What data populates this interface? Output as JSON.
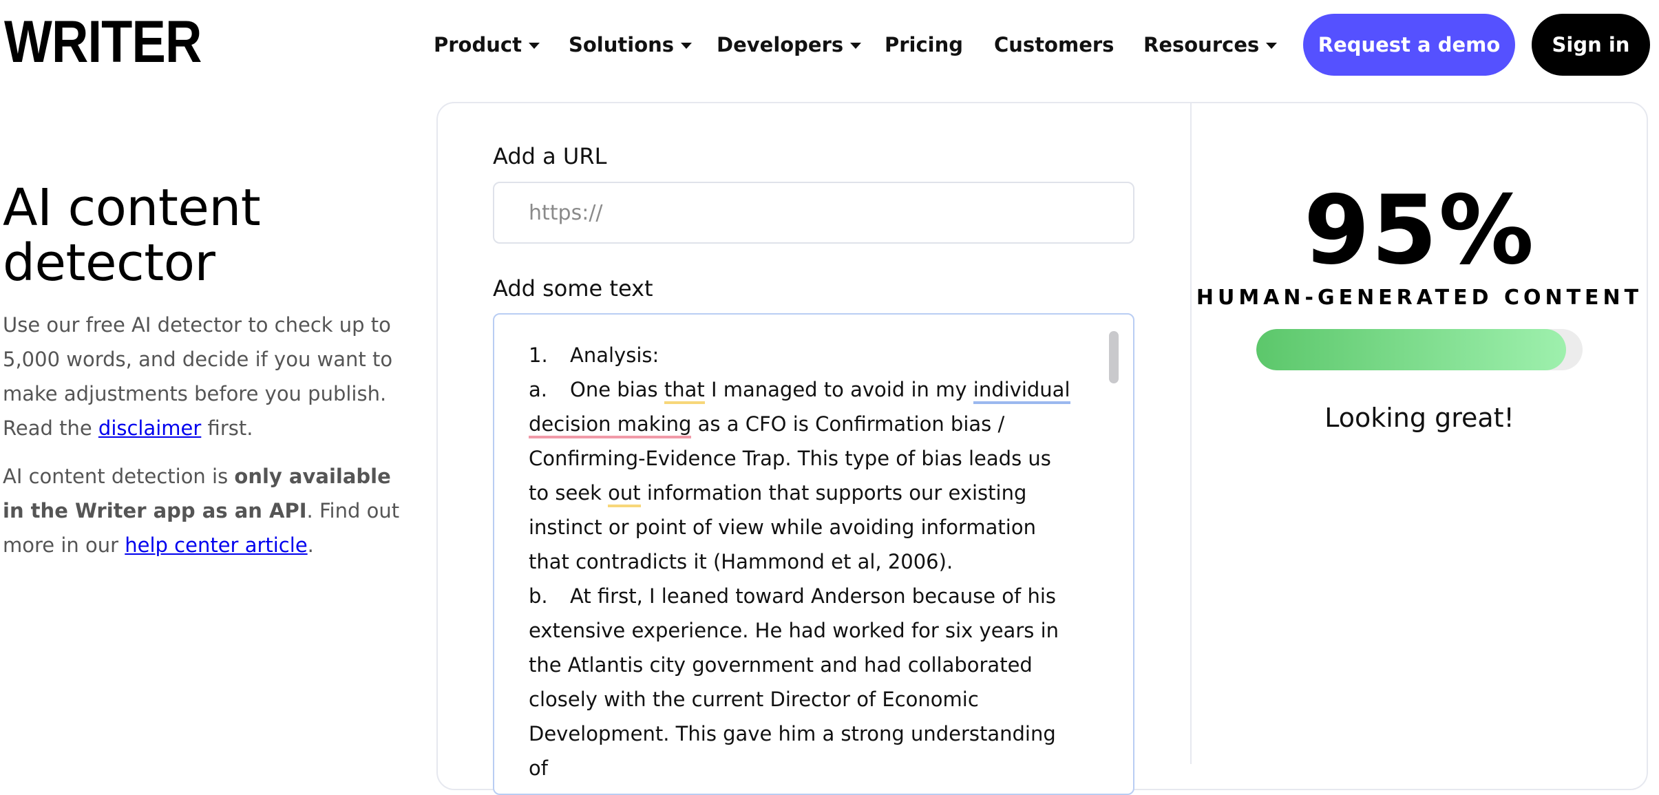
{
  "brand": {
    "logo_text": "WRITER"
  },
  "nav": {
    "items": [
      {
        "label": "Product",
        "has_dropdown": true
      },
      {
        "label": "Solutions",
        "has_dropdown": true
      },
      {
        "label": "Developers",
        "has_dropdown": true
      },
      {
        "label": "Pricing",
        "has_dropdown": false
      },
      {
        "label": "Customers",
        "has_dropdown": false
      },
      {
        "label": "Resources",
        "has_dropdown": true
      }
    ],
    "demo_label": "Request a demo",
    "signin_label": "Sign in"
  },
  "hero": {
    "title": "AI content detector",
    "desc1_pre": "Use our free AI detector to check up to 5,000 words, and decide if you want to make adjustments before you publish. Read the ",
    "desc1_link": "disclaimer",
    "desc1_post": " first.",
    "desc2_pre": "AI content detection is ",
    "desc2_bold": "only available in the Writer app as an API",
    "desc2_mid": ". Find out more in our ",
    "desc2_link": "help center article",
    "desc2_post": "."
  },
  "form": {
    "url_label": "Add a URL",
    "url_placeholder": "https://",
    "text_label": "Add some text",
    "p1_num": "1.",
    "p1_text": "Analysis:",
    "p2_num": "a.",
    "p2_t1": "One bias ",
    "p2_u1": "that",
    "p2_t2": " I managed to avoid in my ",
    "p2_u2": "individual",
    "p2_t3": " ",
    "p2_u3": "decision making",
    "p2_t4": " as a CFO is Confirmation bias / Confirming-Evidence Trap. This type of bias leads us to seek ",
    "p2_u4": "out",
    "p2_t5": " information that supports our existing instinct or point of view while avoiding information that contradicts it (Hammond et al, 2006).",
    "p3_num": "b.",
    "p3_text": "At first, I leaned toward Anderson because of his extensive experience. He had worked for six years in the Atlantis city government and had collaborated closely with the current Director of Economic Development. This gave him a strong understanding of"
  },
  "result": {
    "score": "95%",
    "score_fraction": 0.95,
    "label": "HUMAN-GENERATED CONTENT",
    "status": "Looking great!",
    "accent": "#5551ff",
    "progress_colors": [
      "#5cc76b",
      "#9ef0ad"
    ]
  }
}
